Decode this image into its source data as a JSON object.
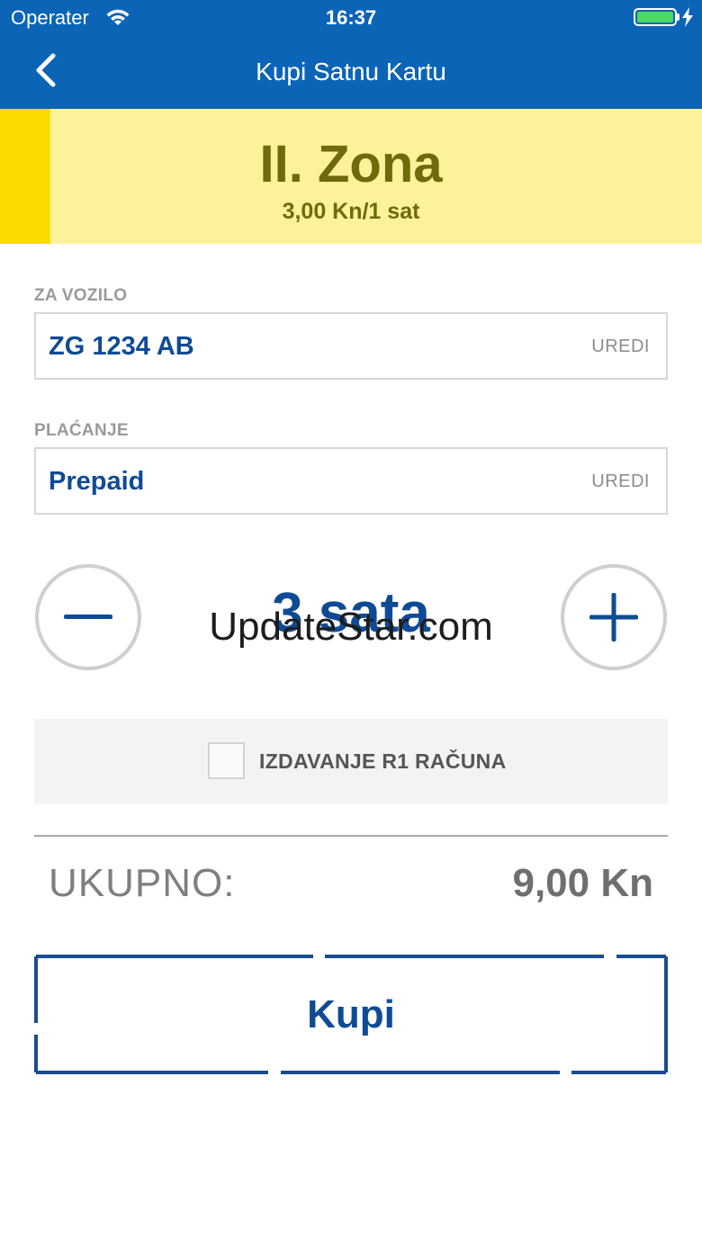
{
  "status_bar": {
    "carrier": "Operater",
    "time": "16:37"
  },
  "nav": {
    "title": "Kupi Satnu Kartu"
  },
  "zone": {
    "name": "II. Zona",
    "price": "3,00 Kn/1 sat"
  },
  "vehicle": {
    "label": "ZA VOZILO",
    "value": "ZG 1234 AB",
    "edit": "UREDI"
  },
  "payment": {
    "label": "PLAĆANJE",
    "value": "Prepaid",
    "edit": "UREDI"
  },
  "duration": {
    "value": "3 sata"
  },
  "watermark": "UpdateStar.com",
  "r1": {
    "label": "IZDAVANJE R1 RAČUNA",
    "checked": false
  },
  "total": {
    "label": "UKUPNO:",
    "value": "9,00 Kn"
  },
  "buy_button": {
    "label": "Kupi"
  },
  "colors": {
    "brand_blue": "#0c64b6",
    "text_blue": "#0f4b95",
    "zone_bg": "#fbf29b",
    "zone_stripe": "#fbdb00",
    "zone_text": "#6e6a0e",
    "battery": "#4cd964"
  }
}
